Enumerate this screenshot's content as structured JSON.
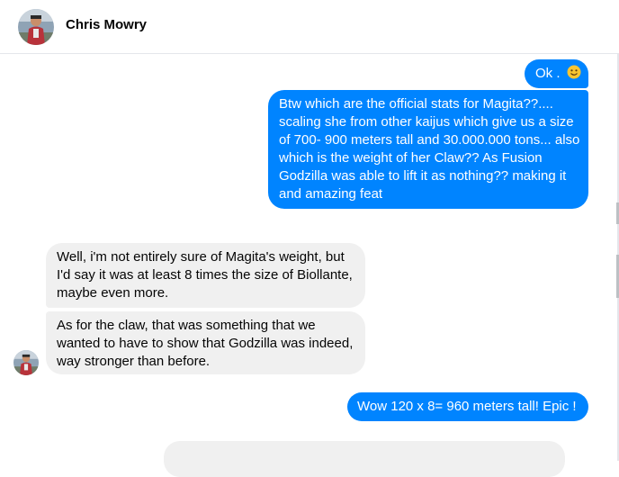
{
  "header": {
    "contact_name": "Chris Mowry",
    "avatar_icon": "profile-photo-avatar"
  },
  "messages": [
    {
      "direction": "outgoing",
      "lines": [
        "Ok . "
      ],
      "emoji": "smiling-face-emoji"
    },
    {
      "direction": "outgoing",
      "lines": [
        "Btw which are the official stats for Magita??....",
        "scaling she from other kaijus which give us a size",
        "of 700- 900 meters tall and 30.000.000 tons... also",
        "which is the weight of her Claw??  As Fusion",
        "Godzilla was able to lift it as nothing?? making it",
        "and amazing feat"
      ]
    },
    {
      "direction": "incoming",
      "lines": [
        "Well, i'm not entirely sure of Magita's weight, but",
        "I'd say it was at least 8 times the size of Biollante,",
        "maybe even more."
      ]
    },
    {
      "direction": "incoming",
      "lines": [
        "As for the claw, that was something that we",
        "wanted to have to show that Godzilla was indeed,",
        "way stronger than before."
      ]
    },
    {
      "direction": "outgoing",
      "lines": [
        "Wow 120 x 8=  960 meters tall! Epic !"
      ]
    }
  ],
  "colors": {
    "outgoing_bubble": "#0084ff",
    "incoming_bubble": "#f0f0f0",
    "divider": "#e4e6eb"
  }
}
